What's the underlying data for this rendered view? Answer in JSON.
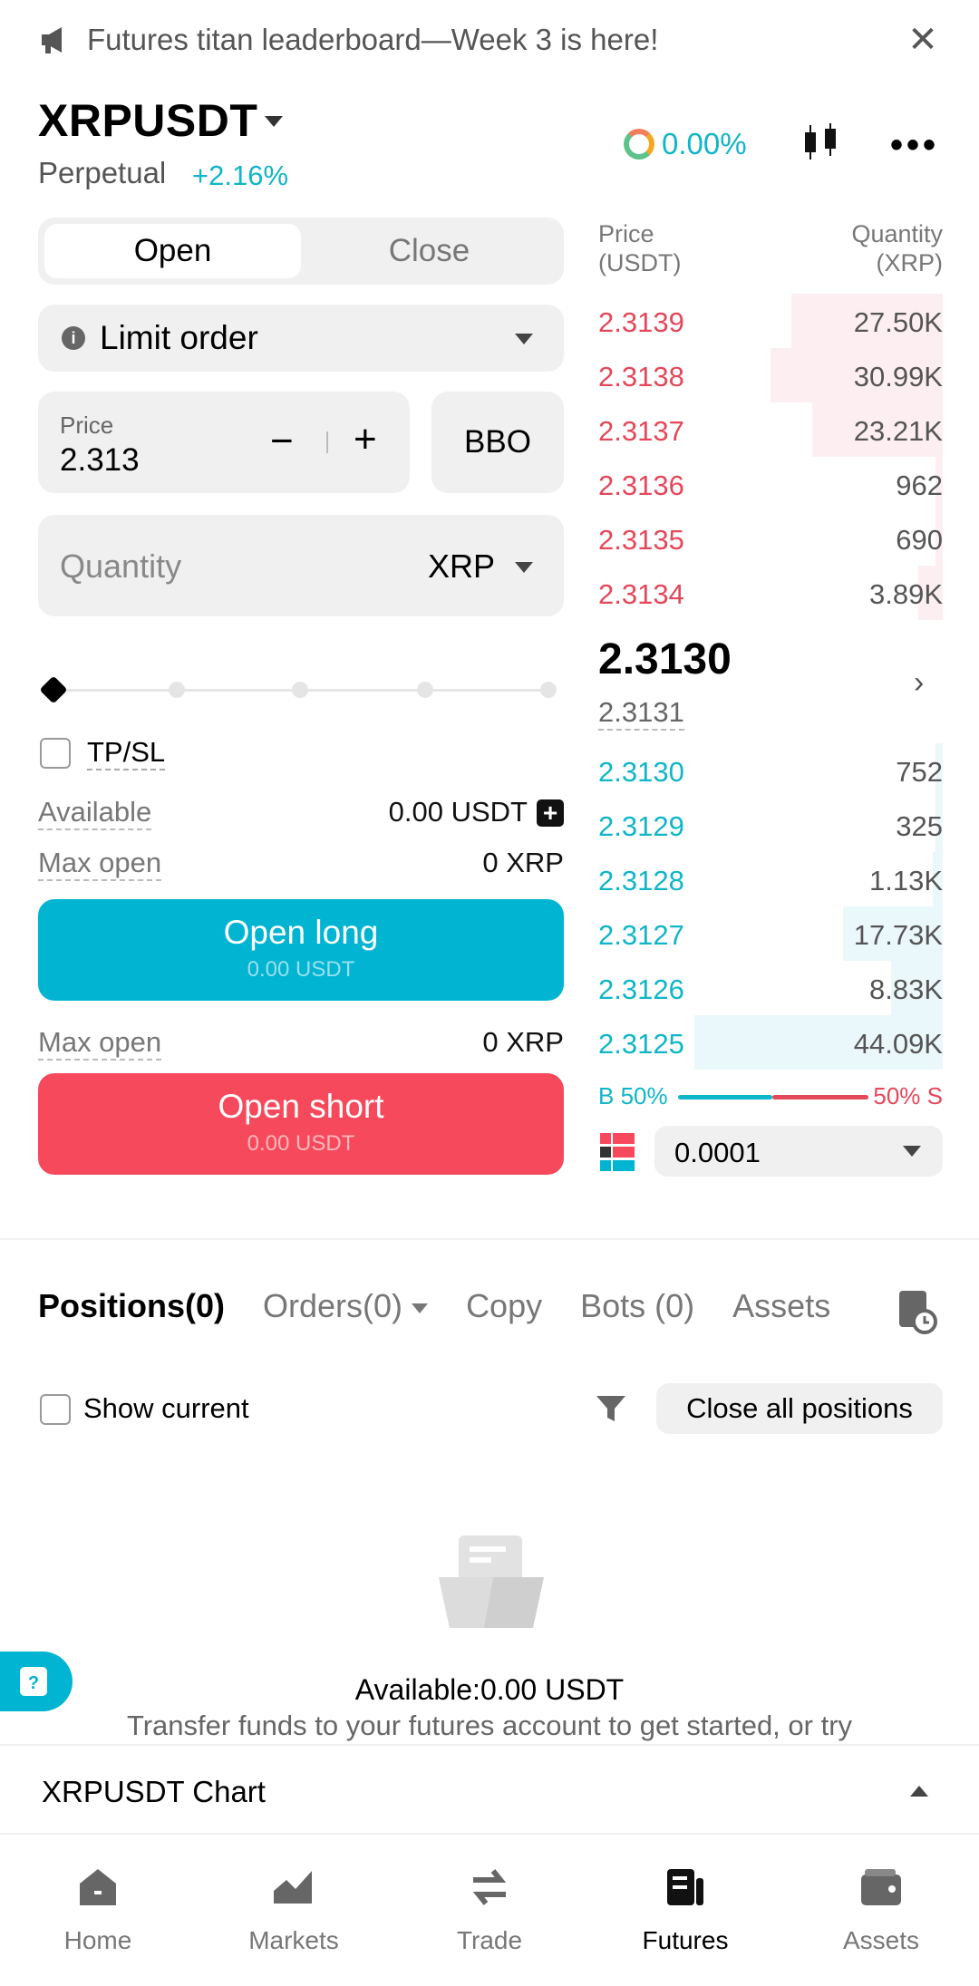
{
  "announcement": {
    "text": "Futures titan leaderboard—Week 3 is here!",
    "close_icon": "close-icon"
  },
  "header": {
    "symbol": "XRPUSDT",
    "type": "Perpetual",
    "change": "+2.16%",
    "funding_rate": "0.00%"
  },
  "form": {
    "tabs": [
      "Open",
      "Close"
    ],
    "active_tab": "Open",
    "order_type": "Limit order",
    "price_label": "Price",
    "price_value": "2.313",
    "minus": "−",
    "plus": "+",
    "bbo": "BBO",
    "quantity_placeholder": "Quantity",
    "quantity_unit": "XRP",
    "slider_level": 0,
    "tpsl_label": "TP/SL",
    "available_label": "Available",
    "available_value": "0.00 USDT",
    "max_open_label": "Max open",
    "max_open_long": "0 XRP",
    "max_open_short": "0 XRP",
    "long_label": "Open long",
    "long_sub": "0.00 USDT",
    "short_label": "Open short",
    "short_sub": "0.00 USDT"
  },
  "orderbook": {
    "price_header": "Price",
    "price_unit": "(USDT)",
    "qty_header": "Quantity",
    "qty_unit": "(XRP)",
    "asks": [
      {
        "price": "2.3139",
        "qty": "27.50K",
        "depth": 0.44
      },
      {
        "price": "2.3138",
        "qty": "30.99K",
        "depth": 0.5
      },
      {
        "price": "2.3137",
        "qty": "23.21K",
        "depth": 0.38
      },
      {
        "price": "2.3136",
        "qty": "962",
        "depth": 0.02
      },
      {
        "price": "2.3135",
        "qty": "690",
        "depth": 0.02
      },
      {
        "price": "2.3134",
        "qty": "3.89K",
        "depth": 0.07
      }
    ],
    "last_price": "2.3130",
    "mark_price": "2.3131",
    "bids": [
      {
        "price": "2.3130",
        "qty": "752",
        "depth": 0.02
      },
      {
        "price": "2.3129",
        "qty": "325",
        "depth": 0.02
      },
      {
        "price": "2.3128",
        "qty": "1.13K",
        "depth": 0.03
      },
      {
        "price": "2.3127",
        "qty": "17.73K",
        "depth": 0.29
      },
      {
        "price": "2.3126",
        "qty": "8.83K",
        "depth": 0.15
      },
      {
        "price": "2.3125",
        "qty": "44.09K",
        "depth": 0.72
      }
    ],
    "buy_ratio": "B 50%",
    "sell_ratio": "50% S",
    "buy_fraction": 0.5,
    "precision": "0.0001"
  },
  "positions": {
    "tabs": [
      "Positions(0)",
      "Orders(0)",
      "Copy",
      "Bots (0)",
      "Assets"
    ],
    "show_current": "Show current",
    "close_all": "Close all positions",
    "empty_available": "Available:0.00 USDT",
    "empty_hint": "Transfer funds to your futures account to get started, or try"
  },
  "chart_bar": {
    "title": "XRPUSDT Chart"
  },
  "nav": [
    {
      "label": "Home",
      "icon": "home-icon"
    },
    {
      "label": "Markets",
      "icon": "markets-icon"
    },
    {
      "label": "Trade",
      "icon": "trade-icon"
    },
    {
      "label": "Futures",
      "icon": "futures-icon"
    },
    {
      "label": "Assets",
      "icon": "wallet-icon"
    }
  ],
  "colors": {
    "accent": "#00b4d2",
    "sell": "#f64a5c",
    "ask_bg": "#fdeff1",
    "bid_bg": "#ebf8fb"
  }
}
